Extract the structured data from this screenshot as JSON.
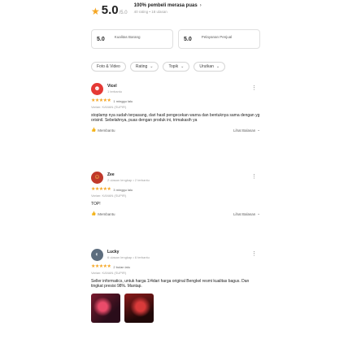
{
  "summary": {
    "score": "5.0",
    "score_max": "/5.0",
    "satisfied_text": "100% pembeli merasa puas",
    "sub_text": "40 rating • 18 ulasan"
  },
  "sub_ratings": [
    {
      "score": "5.0",
      "label": "Kualitas Barang"
    },
    {
      "score": "5.0",
      "label": "Pelayanan Penjual"
    }
  ],
  "filters": [
    {
      "label": "Foto & Video",
      "has_chevron": false
    },
    {
      "label": "Rating",
      "has_chevron": true
    },
    {
      "label": "Topik",
      "has_chevron": true
    },
    {
      "label": "Urutkan",
      "has_chevron": true
    }
  ],
  "reviews": [
    {
      "name": "Vicel",
      "meta": "1 terbantu",
      "stars": "★★★★★",
      "time": "1 minggu lalu",
      "variant": "Varian: KANAN (SUPIR)",
      "text": "stoplamp nya sudah terpasang, dari hasil pengecekan warna dan bentuknya sama dengan yg orisinil. Sebelahnya, puas dengan produk ini, trimakasih ya",
      "helpful": "Membantu",
      "reply": "Lihat Balasan",
      "avatar_color": "#e53935",
      "avatar_icon": "☻"
    },
    {
      "name": "Zee",
      "meta": "2 ulasan lengkap • 2 terbantu",
      "stars": "★★★★★",
      "time": "3 minggu lalu",
      "variant": "Varian: KANAN (SUPIR)",
      "text": "TOP!",
      "helpful": "Membantu",
      "reply": "Lihat Balasan",
      "avatar_color": "#c0392b",
      "avatar_icon": "☺"
    },
    {
      "name": "Lucky",
      "meta": "6 ulasan lengkap • 6 terbantu",
      "stars": "★★★★★",
      "time": "2 bulan lalu",
      "variant": "Varian: KANAN (SUPIR)",
      "text": "Seller informatics, untuk harga 1/4dari harga original Bengkel resmi kualitas bagus. Dan tingkat presisi 98%. Mantap.",
      "helpful": "",
      "reply": "",
      "avatar_color": "#5d6d7e",
      "avatar_icon": "◐",
      "photos": [
        "review-photo-1",
        "review-photo-2"
      ]
    }
  ],
  "icons": {
    "star": "star-icon",
    "chevron_right": "chevron-right-icon",
    "chevron_down": "chevron-down-icon",
    "kebab": "kebab-menu-icon",
    "thumb": "thumbs-up-icon"
  },
  "colors": {
    "star": "#f5a623",
    "text": "#212121",
    "muted": "#9e9e9e",
    "border": "#e0e0e0"
  }
}
